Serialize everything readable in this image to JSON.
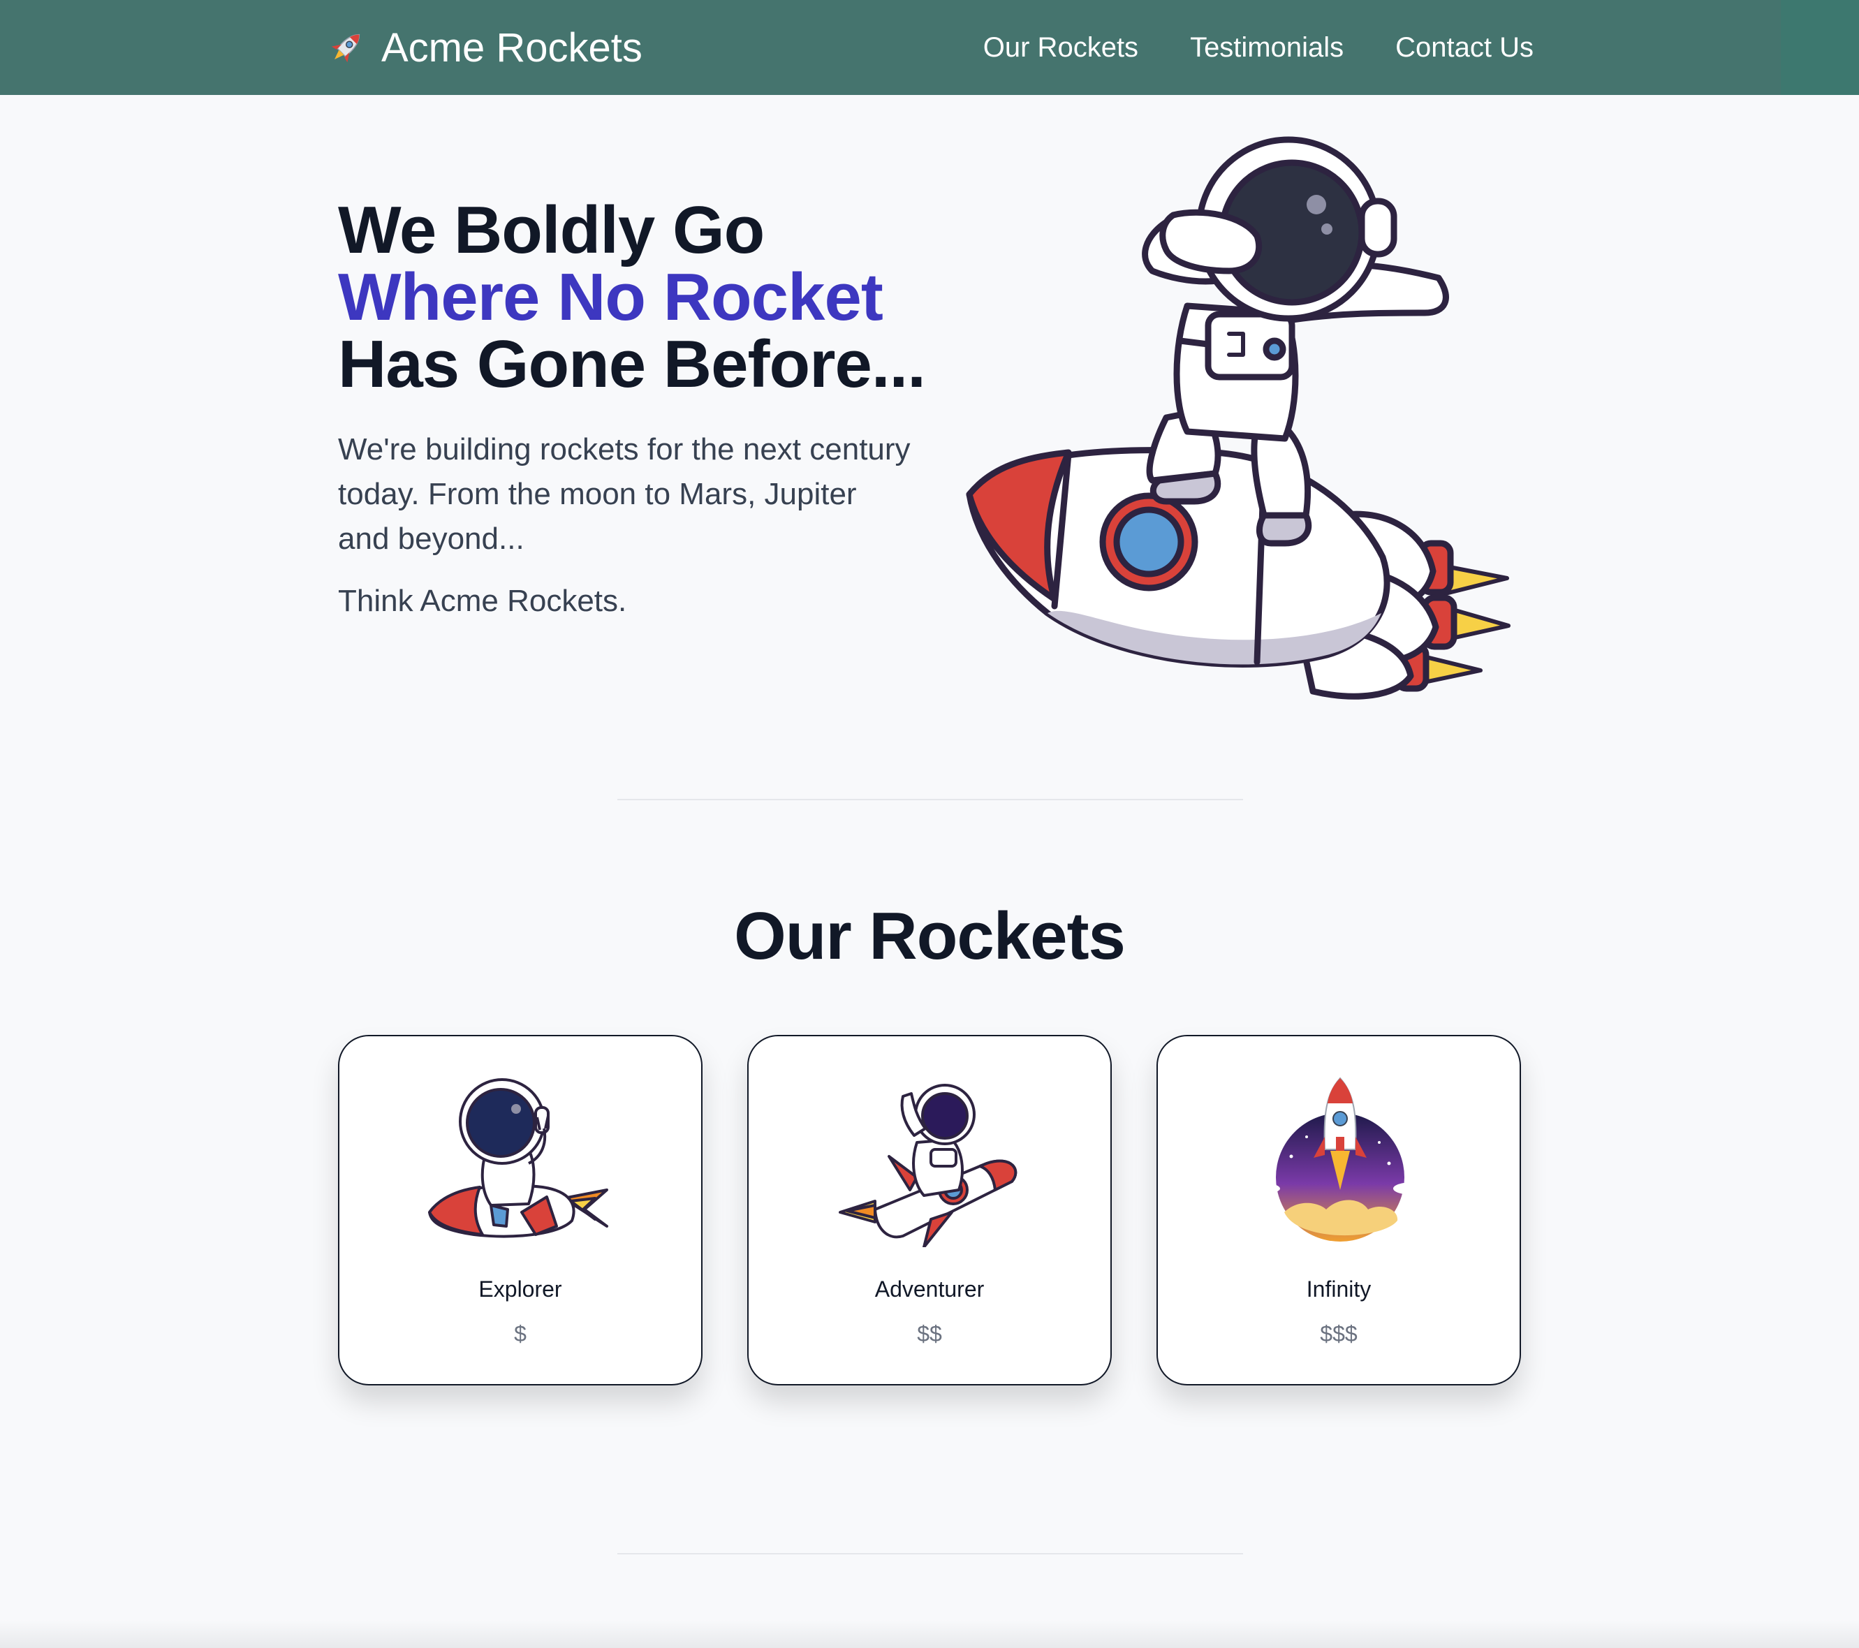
{
  "nav": {
    "brand": "Acme Rockets",
    "brand_icon": "rocket-icon",
    "links": [
      "Our Rockets",
      "Testimonials",
      "Contact Us"
    ]
  },
  "hero": {
    "line1": "We Boldly Go",
    "line2": "Where No Rocket",
    "line3": "Has Gone Before...",
    "subtitle": "We're building rockets for the next century today. From the moon to Mars, Jupiter and beyond...",
    "tagline": "Think Acme Rockets.",
    "image": "astronaut-dabbing-on-rocket-illustration"
  },
  "rockets_section": {
    "title": "Our Rockets",
    "cards": [
      {
        "name": "Explorer",
        "price": "$",
        "image": "astronaut-riding-rocket-illustration"
      },
      {
        "name": "Adventurer",
        "price": "$$",
        "image": "astronaut-waving-on-rocket-illustration"
      },
      {
        "name": "Infinity",
        "price": "$$$",
        "image": "rocket-launch-circle-illustration"
      }
    ]
  },
  "colors": {
    "navbar": "#45746e",
    "accent": "#3d37c0",
    "text": "#111827",
    "background": "#f8f9fb"
  }
}
